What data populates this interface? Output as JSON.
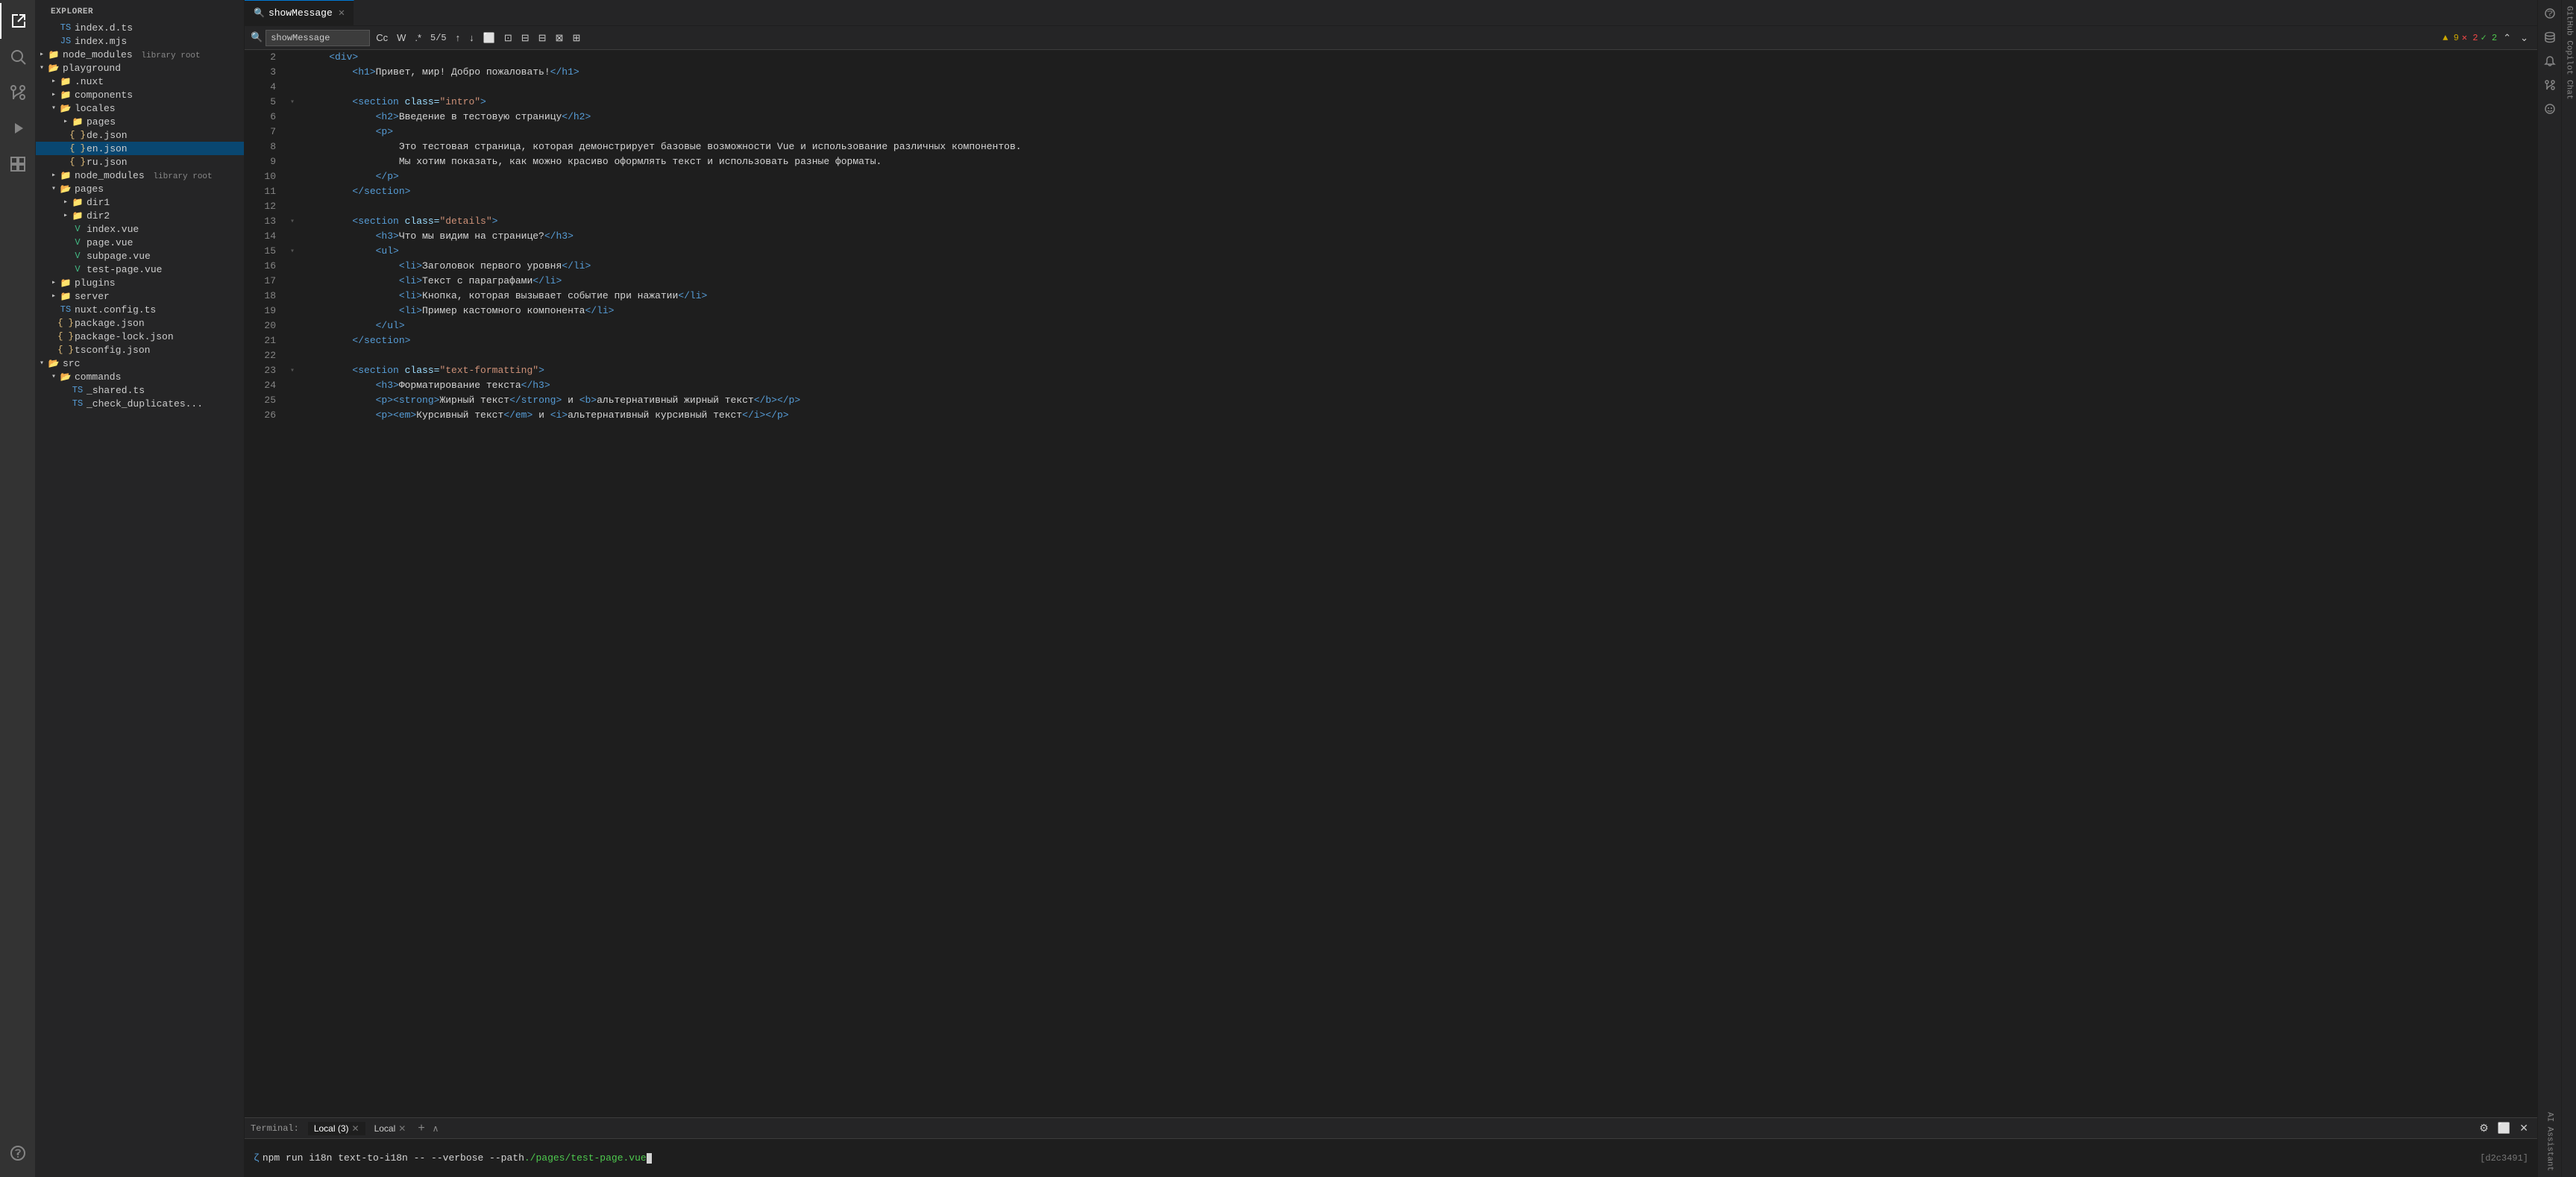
{
  "sidebar": {
    "title": "EXPLORER",
    "tree": [
      {
        "id": "index-d-ts",
        "label": "index.d.ts",
        "type": "ts",
        "indent": 1,
        "hasArrow": false
      },
      {
        "id": "index-mjs",
        "label": "index.mjs",
        "type": "mjs",
        "indent": 1,
        "hasArrow": false
      },
      {
        "id": "node-modules-root",
        "label": "node_modules",
        "badge": "library root",
        "type": "folder",
        "indent": 0,
        "open": false
      },
      {
        "id": "playground",
        "label": "playground",
        "type": "folder",
        "indent": 0,
        "open": true
      },
      {
        "id": "nuxt",
        "label": ".nuxt",
        "type": "folder",
        "indent": 1,
        "open": false
      },
      {
        "id": "components",
        "label": "components",
        "type": "folder",
        "indent": 1,
        "open": false
      },
      {
        "id": "locales",
        "label": "locales",
        "type": "folder",
        "indent": 1,
        "open": true
      },
      {
        "id": "pages",
        "label": "pages",
        "type": "folder",
        "indent": 2,
        "open": false
      },
      {
        "id": "de-json",
        "label": "de.json",
        "type": "json",
        "indent": 2,
        "hasArrow": false
      },
      {
        "id": "en-json",
        "label": "en.json",
        "type": "json",
        "indent": 2,
        "hasArrow": false,
        "selected": true
      },
      {
        "id": "ru-json",
        "label": "ru.json",
        "type": "json",
        "indent": 2,
        "hasArrow": false
      },
      {
        "id": "node-modules-2",
        "label": "node_modules",
        "badge": "library root",
        "type": "folder",
        "indent": 1,
        "open": false
      },
      {
        "id": "pages2",
        "label": "pages",
        "type": "folder",
        "indent": 1,
        "open": true
      },
      {
        "id": "dir1",
        "label": "dir1",
        "type": "folder",
        "indent": 2,
        "open": false
      },
      {
        "id": "dir2",
        "label": "dir2",
        "type": "folder",
        "indent": 2,
        "open": false
      },
      {
        "id": "index-vue",
        "label": "index.vue",
        "type": "vue",
        "indent": 2,
        "hasArrow": false
      },
      {
        "id": "page-vue",
        "label": "page.vue",
        "type": "vue",
        "indent": 2,
        "hasArrow": false
      },
      {
        "id": "subpage-vue",
        "label": "subpage.vue",
        "type": "vue",
        "indent": 2,
        "hasArrow": false
      },
      {
        "id": "test-page-vue",
        "label": "test-page.vue",
        "type": "vue",
        "indent": 2,
        "hasArrow": false
      },
      {
        "id": "plugins",
        "label": "plugins",
        "type": "folder",
        "indent": 1,
        "open": false
      },
      {
        "id": "server",
        "label": "server",
        "type": "folder",
        "indent": 1,
        "open": false
      },
      {
        "id": "nuxt-config",
        "label": "nuxt.config.ts",
        "type": "ts",
        "indent": 1,
        "hasArrow": false
      },
      {
        "id": "package-json",
        "label": "package.json",
        "type": "json",
        "indent": 1,
        "hasArrow": false
      },
      {
        "id": "package-lock-json",
        "label": "package-lock.json",
        "type": "json",
        "indent": 1,
        "hasArrow": false
      },
      {
        "id": "tsconfig-json",
        "label": "tsconfig.json",
        "type": "json",
        "indent": 1,
        "hasArrow": false
      },
      {
        "id": "src",
        "label": "src",
        "type": "folder",
        "indent": 0,
        "open": true
      },
      {
        "id": "commands",
        "label": "commands",
        "type": "folder",
        "indent": 1,
        "open": true
      },
      {
        "id": "shared-ts",
        "label": "_shared.ts",
        "type": "ts",
        "indent": 2,
        "hasArrow": false
      },
      {
        "id": "check-dup",
        "label": "_check_duplicates...",
        "type": "ts",
        "indent": 2,
        "hasArrow": false
      }
    ]
  },
  "tab": {
    "label": "showMessage",
    "icon": "search"
  },
  "toolbar": {
    "search_label": "showMessage",
    "count": "5/5",
    "btn_prev": "↑",
    "btn_next": "↓",
    "btn_whole": "W",
    "btn_case": "Cc",
    "btn_regex": ".*",
    "btn_filter": "⊟",
    "warnings": "▲ 9",
    "errors": "✕ 2",
    "ok": "✓ 2"
  },
  "code": {
    "lines": [
      {
        "num": 2,
        "content": "    <div>",
        "fold": false
      },
      {
        "num": 3,
        "content": "        <h1>Привет, мир! Добро пожаловать!</h1>",
        "fold": false
      },
      {
        "num": 4,
        "content": "",
        "fold": false
      },
      {
        "num": 5,
        "content": "        <section class=\"intro\">",
        "fold": true
      },
      {
        "num": 6,
        "content": "            <h2>Введение в тестовую страницу</h2>",
        "fold": false
      },
      {
        "num": 7,
        "content": "            <p>",
        "fold": false
      },
      {
        "num": 8,
        "content": "                Это тестовая страница, которая демонстрирует базовые возможности Vue и использование различных компонентов.",
        "fold": false
      },
      {
        "num": 9,
        "content": "                Мы хотим показать, как можно красиво оформлять текст и использовать разные форматы.",
        "fold": false
      },
      {
        "num": 10,
        "content": "            </p>",
        "fold": false
      },
      {
        "num": 11,
        "content": "        </section>",
        "fold": false
      },
      {
        "num": 12,
        "content": "",
        "fold": false
      },
      {
        "num": 13,
        "content": "        <section class=\"details\">",
        "fold": true
      },
      {
        "num": 14,
        "content": "            <h3>Что мы видим на странице?</h3>",
        "fold": false
      },
      {
        "num": 15,
        "content": "            <ul>",
        "fold": true
      },
      {
        "num": 16,
        "content": "                <li>Заголовок первого уровня</li>",
        "fold": false
      },
      {
        "num": 17,
        "content": "                <li>Текст с параграфами</li>",
        "fold": false
      },
      {
        "num": 18,
        "content": "                <li>Кнопка, которая вызывает событие при нажатии</li>",
        "fold": false
      },
      {
        "num": 19,
        "content": "                <li>Пример кастомного компонента</li>",
        "fold": false
      },
      {
        "num": 20,
        "content": "            </ul>",
        "fold": false
      },
      {
        "num": 21,
        "content": "        </section>",
        "fold": false
      },
      {
        "num": 22,
        "content": "",
        "fold": false
      },
      {
        "num": 23,
        "content": "        <section class=\"text-formatting\">",
        "fold": true
      },
      {
        "num": 24,
        "content": "            <h3>Форматирование текста</h3>",
        "fold": false
      },
      {
        "num": 25,
        "content": "            <p><strong>Жирный текст</strong> и <b>альтернативный жирный текст</b></p>",
        "fold": false
      },
      {
        "num": 26,
        "content": "            <p><em>Курсивный текст</em> и <i>альтернативный курсивный текст</i></p>",
        "fold": false
      }
    ]
  },
  "terminal": {
    "label": "Terminal:",
    "tabs": [
      {
        "label": "Local (3)",
        "active": true
      },
      {
        "label": "Local",
        "active": false
      }
    ],
    "command": "npm run i18n text-to-i18n -- --verbose --path ./pages/test-page.vue",
    "git_ref": "[d2c3491]"
  },
  "right_panel": {
    "icons": [
      "AI Assistant",
      "Database",
      "Notifications",
      "Pull Requests",
      "GitHub Copilot"
    ]
  },
  "activity_bar": {
    "icons": [
      "explorer",
      "search",
      "source-control",
      "run-debug",
      "extensions",
      "copilot"
    ]
  }
}
